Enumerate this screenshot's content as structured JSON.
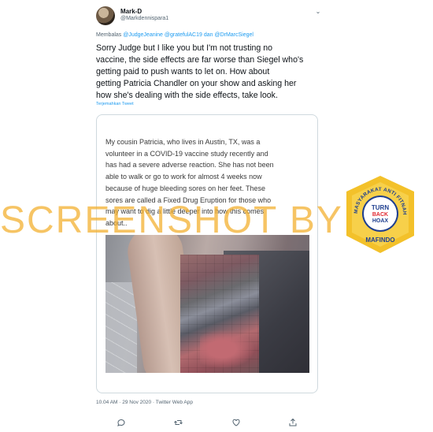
{
  "tweet": {
    "display_name": "Mark-D",
    "handle": "@Markdennispara1",
    "reply_prefix": "Membalas",
    "reply_mentions": [
      "@JudgeJeanine",
      "@gratefulAC19"
    ],
    "reply_and": "dan",
    "reply_last": "@DrMarcSiegel",
    "body_lines": [
      "Sorry Judge but I like you but I'm not trusting no",
      "vaccine, the side effects are far worse than Siegel who's",
      "getting paid to push wants to let on. How about",
      "getting Patricia Chandler on your show and asking her",
      "how she's dealing with the side effects, take look."
    ],
    "translate_label": "Terjemahkan Tweet",
    "timestamp": "10.04 AM · 29 Nov 2020 · Twitter Web App"
  },
  "card": {
    "text_lines": [
      "My cousin Patricia, who lives in Austin, TX, was a",
      "volunteer in a COVID-19 vaccine study recently and",
      "has had a severe adverse reaction. She has not been",
      "able to walk or go to work for almost 4 weeks now",
      "because of huge bleeding sores on her feet. These",
      "sores are called a Fixed Drug Eruption for those who",
      "may want to dig a little deeper into how this comes",
      "about.."
    ]
  },
  "actions": {
    "reply_icon": "reply-icon",
    "retweet_icon": "retweet-icon",
    "like_icon": "like-icon",
    "share_icon": "share-icon"
  },
  "overlay": {
    "watermark": "SCREENSHOT BY",
    "seal_ring_text": "MASYARAKAT ANTI FITNAH INDONESIA",
    "seal_center": [
      "TURN",
      "BACK",
      "HOAX"
    ],
    "seal_bottom": "MAFINDO",
    "seal_color": "#f3c12a",
    "seal_blue": "#1f3f8f"
  }
}
